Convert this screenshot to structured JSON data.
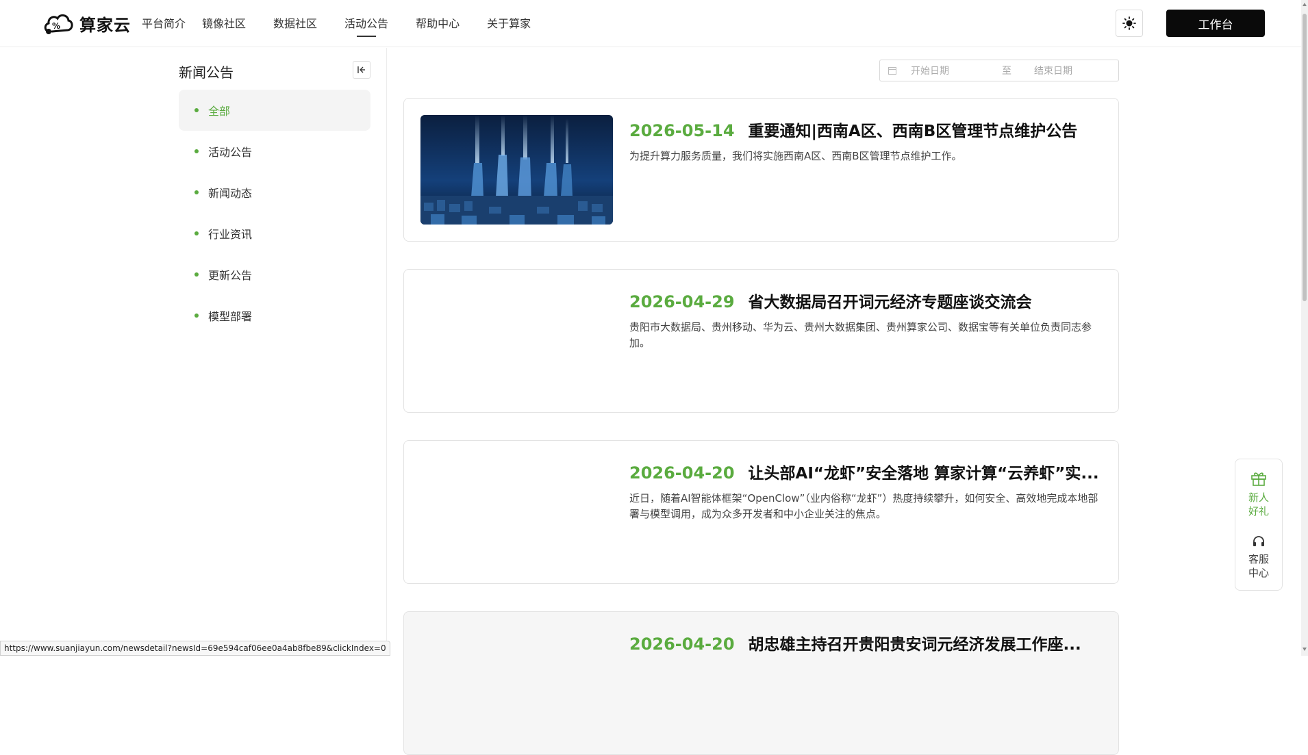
{
  "header": {
    "logo_text": "算家云",
    "nav": [
      {
        "label": "平台简介"
      },
      {
        "label": "镜像社区"
      },
      {
        "label": "数据社区"
      },
      {
        "label": "活动公告",
        "active": true
      },
      {
        "label": "帮助中心"
      },
      {
        "label": "关于算家"
      }
    ],
    "theme_icon": "sun-icon",
    "workbench_label": "工作台"
  },
  "sidebar": {
    "title": "新闻公告",
    "collapse_icon": "collapse-left-icon",
    "items": [
      {
        "label": "全部",
        "active": true
      },
      {
        "label": "活动公告"
      },
      {
        "label": "新闻动态"
      },
      {
        "label": "行业资讯"
      },
      {
        "label": "更新公告"
      },
      {
        "label": "模型部署"
      }
    ]
  },
  "date_range": {
    "start_placeholder": "开始日期",
    "separator": "至",
    "end_placeholder": "结束日期"
  },
  "news": [
    {
      "date": "2026-05-14",
      "title": "重要通知|西南A区、西南B区管理节点维护公告",
      "desc": "为提升算力服务质量，我们将实施西南A区、西南B区管理节点维护工作。",
      "has_image": true
    },
    {
      "date": "2026-04-29",
      "title": "省大数据局召开词元经济专题座谈交流会",
      "desc": "贵阳市大数据局、贵州移动、华为云、贵州大数据集团、贵州算家公司、数据宝等有关单位负责同志参加。",
      "has_image": false
    },
    {
      "date": "2026-04-20",
      "title": "让头部AI“龙虾”安全落地 算家计算“云养虾”实...",
      "desc": "近日，随着AI智能体框架“OpenClow”（业内俗称“龙虾”）热度持续攀升，如何安全、高效地完成本地部署与模型调用，成为众多开发者和中小企业关注的焦点。",
      "has_image": false
    },
    {
      "date": "2026-04-20",
      "title": "胡忠雄主持召开贵阳贵安词元经济发展工作座...",
      "desc": "",
      "has_image": false
    }
  ],
  "float_panel": {
    "gift_label_1": "新人",
    "gift_label_2": "好礼",
    "service_label_1": "客服",
    "service_label_2": "中心"
  },
  "status_url": "https://www.suanjiayun.com/newsdetail?newsId=69e594caf06ee0a4ab8fbe89&clickIndex=0",
  "colors": {
    "accent": "#5aab3f",
    "button_dark": "#0a0a0a"
  }
}
